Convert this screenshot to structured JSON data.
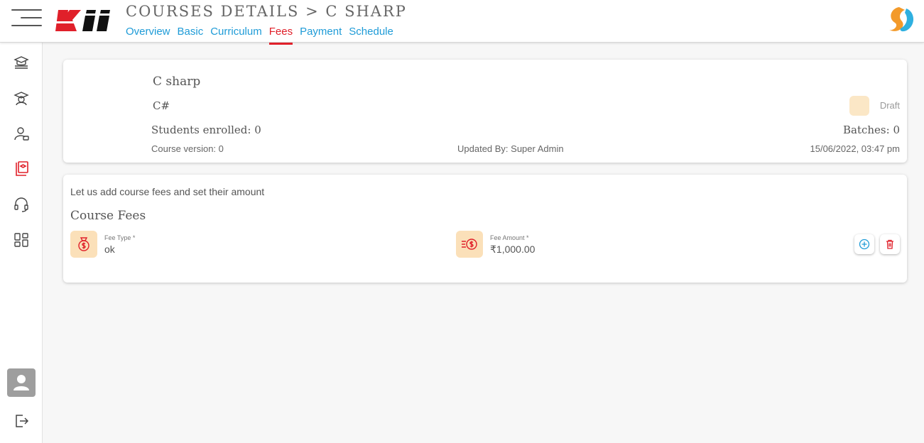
{
  "header": {
    "logo_text": "Kii",
    "title": "COURSES DETAILS > C SHARP",
    "tabs": [
      {
        "label": "Overview",
        "active": false
      },
      {
        "label": "Basic",
        "active": false
      },
      {
        "label": "Curriculum",
        "active": false
      },
      {
        "label": "Fees",
        "active": true
      },
      {
        "label": "Payment",
        "active": false
      },
      {
        "label": "Schedule",
        "active": false
      }
    ]
  },
  "sidebar": {
    "items": [
      {
        "icon": "courses-stack-icon",
        "active": false
      },
      {
        "icon": "graduate-icon",
        "active": false
      },
      {
        "icon": "user-card-icon",
        "active": false
      },
      {
        "icon": "course-book-icon",
        "active": true
      },
      {
        "icon": "headset-icon",
        "active": false
      },
      {
        "icon": "dashboard-grid-icon",
        "active": false
      }
    ],
    "bottom": [
      {
        "icon": "avatar-icon"
      },
      {
        "icon": "logout-icon"
      }
    ]
  },
  "course": {
    "name": "C sharp",
    "code": "C#",
    "students_enrolled": "Students enrolled: 0",
    "status": "Draft",
    "batches": "Batches: 0",
    "version": "Course version: 0",
    "updated_by": "Updated By: Super Admin",
    "updated_at": "15/06/2022, 03:47 pm"
  },
  "fees": {
    "intro": "Let us add course fees and set their amount",
    "section_title": "Course Fees",
    "rows": [
      {
        "fee_type_label": "Fee Type *",
        "fee_type_value": "ok",
        "fee_amount_label": "Fee Amount *",
        "fee_amount_value": "₹1,000.00"
      }
    ]
  },
  "colors": {
    "accent_red": "#e0202a",
    "link_blue": "#1e9bd7",
    "icon_bg": "#fbe0b9",
    "status_swatch": "#fbe7c6"
  }
}
